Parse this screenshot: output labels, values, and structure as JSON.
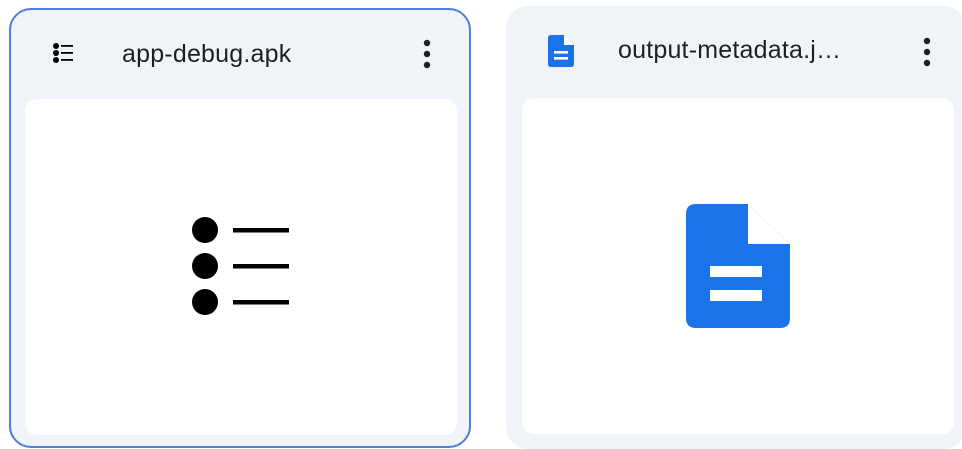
{
  "files": [
    {
      "name": "app-debug.apk",
      "icon": "list-bullets-icon",
      "selected": true,
      "more_label": "More actions"
    },
    {
      "name": "output-metadata.j…",
      "icon": "document-icon",
      "selected": false,
      "more_label": "More actions",
      "accent_color": "#1a73e8"
    }
  ]
}
